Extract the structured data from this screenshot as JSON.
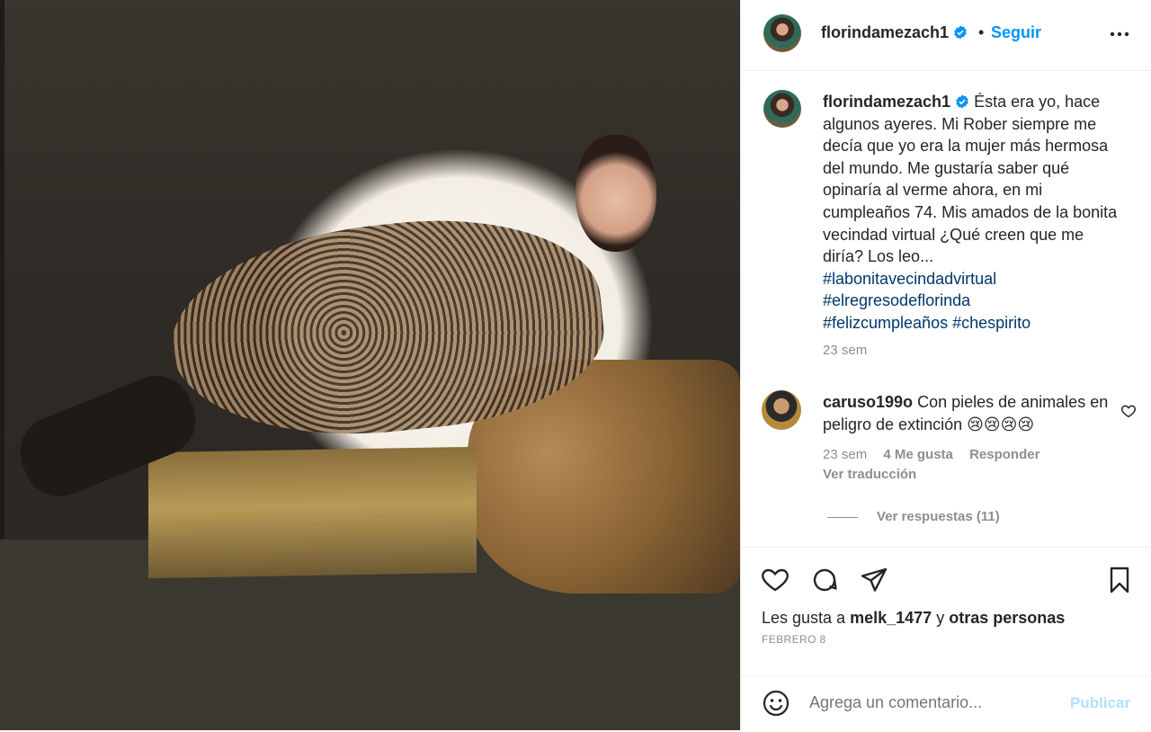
{
  "post": {
    "image_alt": "Photo of a woman in a leopard-print bodysuit reclining on a box covered with animal furs"
  },
  "header": {
    "username": "florindamezach1",
    "separator": "•",
    "follow_label": "Seguir"
  },
  "caption": {
    "username": "florindamezach1",
    "text": "Ésta era yo, hace algunos ayeres. Mi Rober siempre me decía que yo era la mujer más hermosa del mundo. Me gustaría saber qué opinaría al verme ahora, en mi cumpleaños 74. Mis amados de la bonita vecindad virtual ¿Qué creen que me diría? Los leo...",
    "hashtags": [
      "#labonitavecindadvirtual",
      "#elregresodeflorinda",
      "#felizcumpleaños",
      "#chespirito"
    ],
    "time": "23 sem"
  },
  "comment": {
    "username": "caruso199o",
    "text": "Con pieles de animales en peligro de extinción 😢😢😢😢",
    "time": "23 sem",
    "likes": "4 Me gusta",
    "reply_label": "Responder",
    "translate_label": "Ver traducción",
    "view_replies_label": "Ver respuestas (11)"
  },
  "likes": {
    "prefix": "Les gusta a",
    "user": "melk_1477",
    "conj": "y",
    "others": "otras personas"
  },
  "date": "FEBRERO 8",
  "add_comment": {
    "placeholder": "Agrega un comentario...",
    "publish_label": "Publicar"
  },
  "colors": {
    "accent": "#0095f6",
    "hashtag": "#00376b",
    "muted": "#8e8e8e"
  }
}
